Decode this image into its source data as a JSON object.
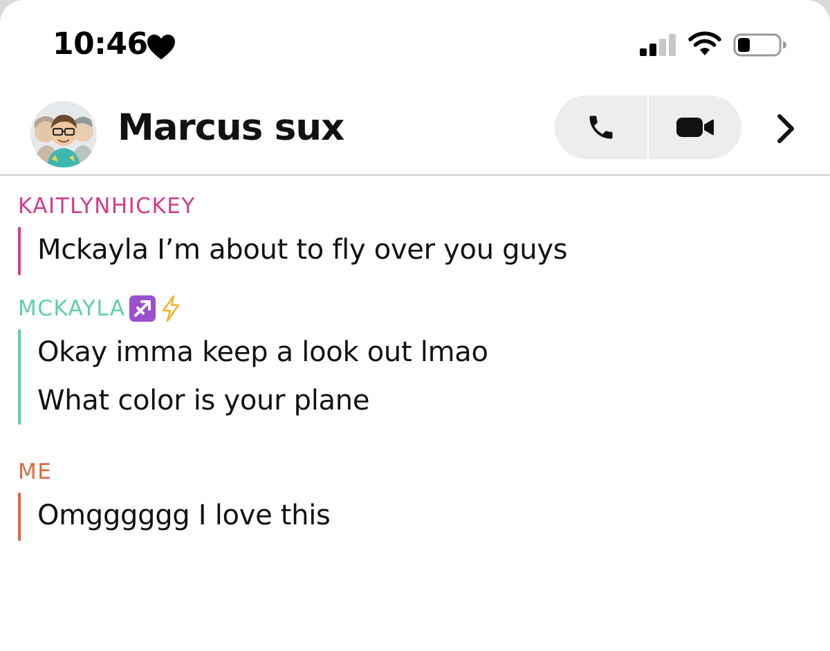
{
  "status_bar": {
    "time": "10:46",
    "heart_icon": "heart-icon",
    "signal_icon": "cellular-signal-icon",
    "wifi_icon": "wifi-icon",
    "battery_icon": "battery-icon",
    "battery_level": 0.3
  },
  "header": {
    "title": "Marcus sux",
    "avatar": "group-avatar",
    "phone_icon": "phone-icon",
    "video_icon": "video-camera-icon",
    "chevron_icon": "chevron-right-icon"
  },
  "colors": {
    "kaitlyn": "#d63a8c",
    "mckayla": "#5fcfa6",
    "me": "#e0663a",
    "text": "#111111",
    "button_bg": "#eceded"
  },
  "messages": [
    {
      "sender": "KAITLYNHICKEY",
      "lines": [
        "Mckayla I’m about to fly over you guys"
      ]
    },
    {
      "sender": "MCKAYLA",
      "sender_emojis": [
        "sagittarius-emoji",
        "lightning-bolt-emoji"
      ],
      "lines": [
        "Okay imma keep a look out lmao",
        "What color is your plane"
      ]
    },
    {
      "sender": "ME",
      "lines": [
        "Omgggggg I love this"
      ]
    }
  ]
}
